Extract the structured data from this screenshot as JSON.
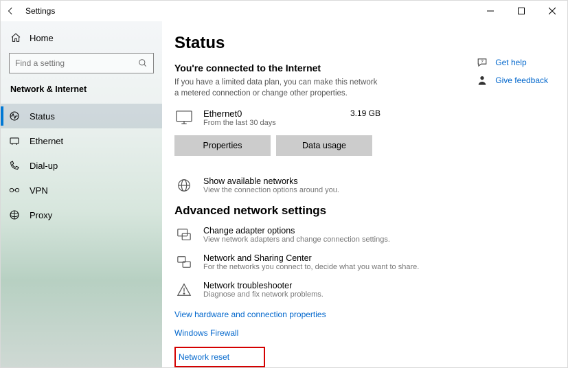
{
  "window": {
    "title": "Settings"
  },
  "home_label": "Home",
  "search": {
    "placeholder": "Find a setting"
  },
  "sidebar_heading": "Network & Internet",
  "nav": {
    "status": "Status",
    "ethernet": "Ethernet",
    "dialup": "Dial-up",
    "vpn": "VPN",
    "proxy": "Proxy"
  },
  "page": {
    "title": "Status",
    "connected_head": "You're connected to the Internet",
    "connected_desc": "If you have a limited data plan, you can make this network a metered connection or change other properties.",
    "adapter_name": "Ethernet0",
    "adapter_sub": "From the last 30 days",
    "adapter_usage": "3.19 GB",
    "btn_properties": "Properties",
    "btn_datausage": "Data usage",
    "show_networks_title": "Show available networks",
    "show_networks_sub": "View the connection options around you.",
    "advanced_head": "Advanced network settings",
    "adapter_opts_title": "Change adapter options",
    "adapter_opts_sub": "View network adapters and change connection settings.",
    "sharing_title": "Network and Sharing Center",
    "sharing_sub": "For the networks you connect to, decide what you want to share.",
    "troubleshoot_title": "Network troubleshooter",
    "troubleshoot_sub": "Diagnose and fix network problems.",
    "link_hw": "View hardware and connection properties",
    "link_firewall": "Windows Firewall",
    "link_reset": "Network reset"
  },
  "right": {
    "help": "Get help",
    "feedback": "Give feedback"
  }
}
